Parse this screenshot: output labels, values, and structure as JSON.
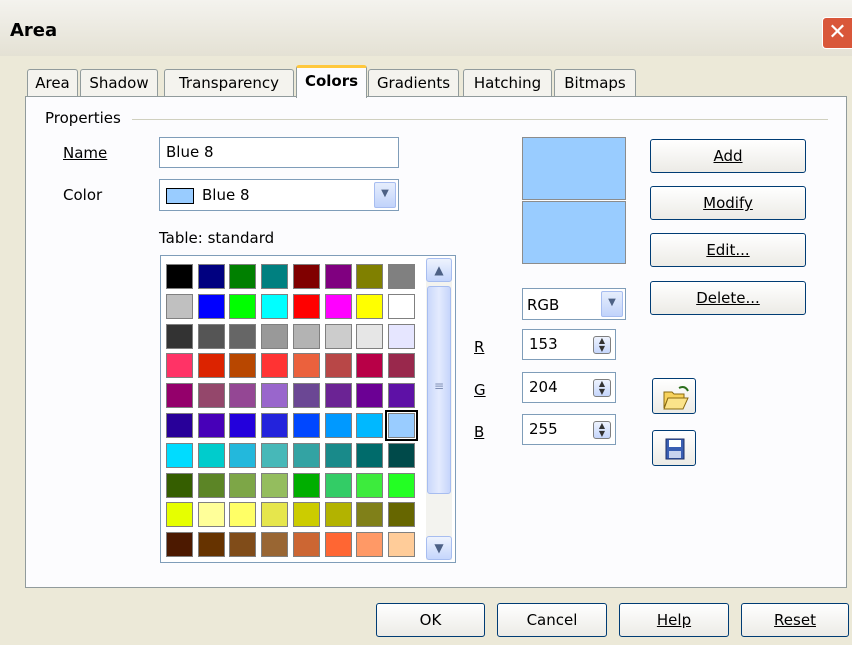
{
  "window": {
    "title": "Area",
    "close_glyph": "✕"
  },
  "tabs": [
    {
      "label": "Area"
    },
    {
      "label": "Shadow"
    },
    {
      "label": "Transparency"
    },
    {
      "label": "Colors"
    },
    {
      "label": "Gradients"
    },
    {
      "label": "Hatching"
    },
    {
      "label": "Bitmaps"
    }
  ],
  "active_tab": "Colors",
  "properties": {
    "legend": "Properties",
    "name_label": "Name",
    "name_value": "Blue 8",
    "color_label": "Color",
    "color_value": "Blue 8",
    "color_hex": "#99ccff",
    "table_label": "Table: standard"
  },
  "palette": [
    [
      "#000000",
      "#000080",
      "#008000",
      "#008080",
      "#800000",
      "#800080",
      "#808000",
      "#808080"
    ],
    [
      "#c0c0c0",
      "#0000ff",
      "#00ff00",
      "#00ffff",
      "#ff0000",
      "#ff00ff",
      "#ffff00",
      "#ffffff"
    ],
    [
      "#333333",
      "#555555",
      "#666666",
      "#999999",
      "#b3b3b3",
      "#cccccc",
      "#e6e6e6",
      "#e6e6ff"
    ],
    [
      "#ff3366",
      "#dc2300",
      "#b84700",
      "#ff3333",
      "#eb613d",
      "#b84747",
      "#b80047",
      "#99284c"
    ],
    [
      "#94006b",
      "#94476b",
      "#944794",
      "#9966cc",
      "#6b4794",
      "#6b2394",
      "#6b0094",
      "#5e11a6"
    ],
    [
      "#280099",
      "#4700b8",
      "#2300dc",
      "#2323dc",
      "#0047ff",
      "#0099ff",
      "#00b8ff",
      "#99ccff"
    ],
    [
      "#00dcff",
      "#00cccc",
      "#23b8dc",
      "#47b8b8",
      "#33a3a3",
      "#198a8a",
      "#006b6b",
      "#004a4a"
    ],
    [
      "#355e00",
      "#5c8526",
      "#7da647",
      "#94bd5e",
      "#00ae00",
      "#33cc66",
      "#3deb3d",
      "#23ff23"
    ],
    [
      "#e6ff00",
      "#ffff99",
      "#ffff66",
      "#e6e64c",
      "#cccc00",
      "#b3b300",
      "#808019",
      "#666600"
    ],
    [
      "#4c1900",
      "#663300",
      "#804c19",
      "#996633",
      "#cc6633",
      "#ff6633",
      "#ff9966",
      "#ffcc99"
    ]
  ],
  "selected_swatch": "Blue 8",
  "preview": {
    "top_color": "#99ccff",
    "bottom_color": "#99ccff"
  },
  "color_model": "RGB",
  "rgb": {
    "r_label": "R",
    "r_value": "153",
    "g_label": "G",
    "g_value": "204",
    "b_label": "B",
    "b_value": "255"
  },
  "actions": {
    "add": "Add",
    "modify": "Modify",
    "edit": "Edit...",
    "delete": "Delete..."
  },
  "icons": {
    "open": "folder-open-icon",
    "save": "save-disk-icon"
  },
  "footer": {
    "ok": "OK",
    "cancel": "Cancel",
    "help": "Help",
    "reset": "Reset"
  },
  "scrollbar": {
    "up_glyph": "▲",
    "down_glyph": "▼",
    "grip_glyph": "≡"
  },
  "dropdown_glyph": "▼",
  "spin_glyph": "▲▼"
}
